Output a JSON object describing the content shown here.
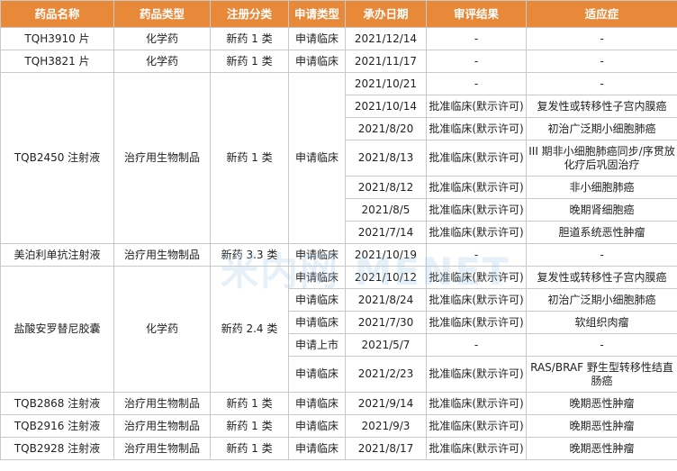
{
  "headers": [
    "药品名称",
    "药品类型",
    "注册分类",
    "申请类型",
    "承办日期",
    "审评结果",
    "适应症"
  ],
  "watermark": "米内网 MENET",
  "groups": [
    {
      "name": "TQH3910 片",
      "type": "化学药",
      "category": "新药 1 类",
      "rows": [
        {
          "apply": "申请临床",
          "date": "2021/12/14",
          "result": "-",
          "indication": "-"
        }
      ]
    },
    {
      "name": "TQH3821 片",
      "type": "化学药",
      "category": "新药 1 类",
      "rows": [
        {
          "apply": "申请临床",
          "date": "2021/11/17",
          "result": "-",
          "indication": "-"
        }
      ]
    },
    {
      "name": "TQB2450 注射液",
      "type": "治疗用生物制品",
      "category": "新药 1 类",
      "apply": "申请临床",
      "rows": [
        {
          "date": "2021/10/21",
          "result": "-",
          "indication": "-"
        },
        {
          "date": "2021/10/14",
          "result": "批准临床(默示许可)",
          "indication": "复发性或转移性子宫内膜癌"
        },
        {
          "date": "2021/8/20",
          "result": "批准临床(默示许可)",
          "indication": "初治广泛期小细胞肺癌"
        },
        {
          "date": "2021/8/13",
          "result": "批准临床(默示许可)",
          "indication": "III 期非小细胞肺癌同步/序贯放化疗后巩固治疗"
        },
        {
          "date": "2021/8/12",
          "result": "批准临床(默示许可)",
          "indication": "非小细胞肺癌"
        },
        {
          "date": "2021/8/5",
          "result": "批准临床(默示许可)",
          "indication": "晚期肾细胞癌"
        },
        {
          "date": "2021/7/14",
          "result": "批准临床(默示许可)",
          "indication": "胆道系统恶性肿瘤"
        }
      ]
    },
    {
      "name": "美泊利单抗注射液",
      "type": "治疗用生物制品",
      "category": "新药 3.3 类",
      "rows": [
        {
          "apply": "申请临床",
          "date": "2021/10/19",
          "result": "-",
          "indication": "-"
        }
      ]
    },
    {
      "name": "盐酸安罗替尼胶囊",
      "type": "化学药",
      "category": "新药 2.4 类",
      "rows": [
        {
          "apply": "申请临床",
          "date": "2021/10/12",
          "result": "批准临床(默示许可)",
          "indication": "复发性或转移性子宫内膜癌"
        },
        {
          "apply": "申请临床",
          "date": "2021/8/24",
          "result": "批准临床(默示许可)",
          "indication": "初治广泛期小细胞肺癌"
        },
        {
          "apply": "申请临床",
          "date": "2021/7/30",
          "result": "批准临床(默示许可)",
          "indication": "软组织肉瘤"
        },
        {
          "apply": "申请上市",
          "date": "2021/5/7",
          "result": "-",
          "indication": "-"
        },
        {
          "apply": "申请临床",
          "date": "2021/2/23",
          "result": "批准临床(默示许可)",
          "indication": "RAS/BRAF 野生型转移性结直肠癌"
        }
      ]
    },
    {
      "name": "TQB2868 注射液",
      "type": "治疗用生物制品",
      "category": "新药 1 类",
      "rows": [
        {
          "apply": "申请临床",
          "date": "2021/9/14",
          "result": "批准临床(默示许可)",
          "indication": "晚期恶性肿瘤"
        }
      ]
    },
    {
      "name": "TQB2916 注射液",
      "type": "治疗用生物制品",
      "category": "新药 1 类",
      "rows": [
        {
          "apply": "申请临床",
          "date": "2021/9/3",
          "result": "批准临床(默示许可)",
          "indication": "晚期恶性肿瘤"
        }
      ]
    },
    {
      "name": "TQB2928 注射液",
      "type": "治疗用生物制品",
      "category": "新药 1 类",
      "rows": [
        {
          "apply": "申请临床",
          "date": "2021/8/17",
          "result": "批准临床(默示许可)",
          "indication": "晚期恶性肿瘤"
        }
      ]
    }
  ]
}
